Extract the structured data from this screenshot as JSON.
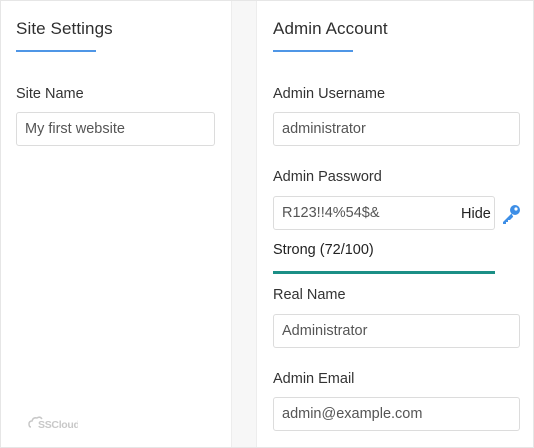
{
  "site_settings": {
    "title": "Site Settings",
    "site_name": {
      "label": "Site Name",
      "value": "My first website"
    }
  },
  "admin_account": {
    "title": "Admin Account",
    "username": {
      "label": "Admin Username",
      "value": "administrator"
    },
    "password": {
      "label": "Admin Password",
      "value": "R123!!4%54$&",
      "toggle_label": "Hide",
      "icon": "key-icon",
      "strength_text": "Strong (72/100)",
      "strength_score": 72,
      "strength_color": "#1b8f86"
    },
    "real_name": {
      "label": "Real Name",
      "value": "Administrator"
    },
    "email": {
      "label": "Admin Email",
      "value": "admin@example.com"
    }
  },
  "logo": {
    "text": "SSCloud"
  },
  "colors": {
    "accent": "#4f96e6",
    "key_icon": "#3d8ee6"
  }
}
